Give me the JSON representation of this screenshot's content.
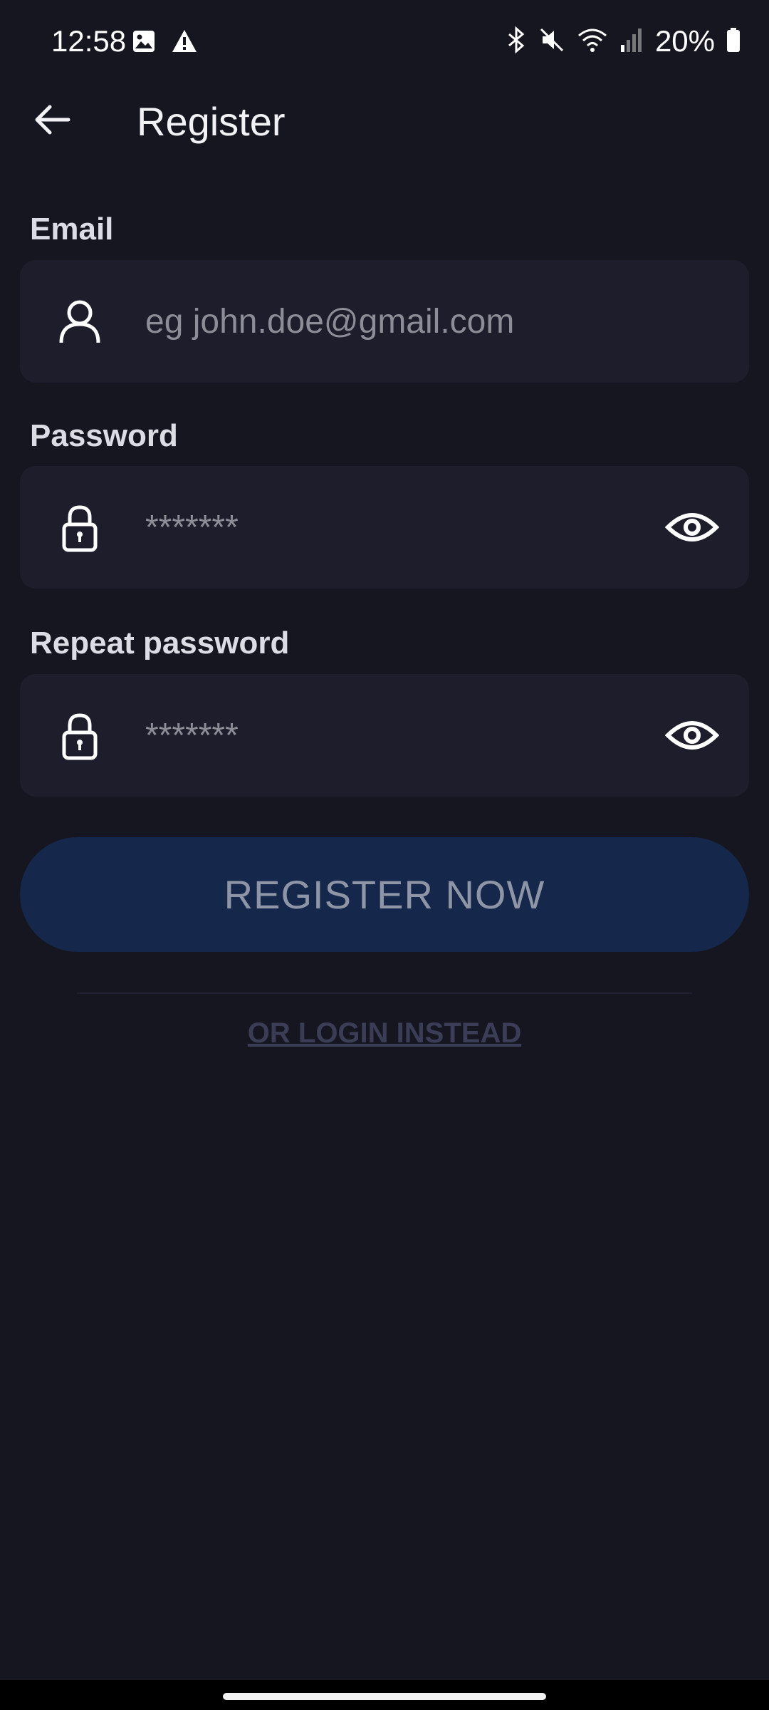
{
  "status_bar": {
    "time": "12:58",
    "battery": "20%",
    "icons": [
      "image-icon",
      "warning-icon",
      "bluetooth-icon",
      "mute-icon",
      "wifi-icon",
      "signal-icon",
      "battery-icon"
    ]
  },
  "header": {
    "title": "Register",
    "back_icon": "back-arrow-icon"
  },
  "form": {
    "email": {
      "label": "Email",
      "placeholder": "eg john.doe@gmail.com",
      "value": "",
      "icon": "user-icon"
    },
    "password": {
      "label": "Password",
      "placeholder": "*******",
      "value": "",
      "icon": "lock-icon",
      "toggle_icon": "eye-icon"
    },
    "repeat_password": {
      "label": "Repeat password",
      "placeholder": "*******",
      "value": "",
      "icon": "lock-icon",
      "toggle_icon": "eye-icon"
    }
  },
  "actions": {
    "register_label": "REGISTER NOW",
    "login_label": "OR LOGIN INSTEAD"
  },
  "colors": {
    "background": "#161620",
    "field": "#1d1d2b",
    "button": "#15274a",
    "button_text": "#8d95a6",
    "link": "#3b3d56"
  }
}
